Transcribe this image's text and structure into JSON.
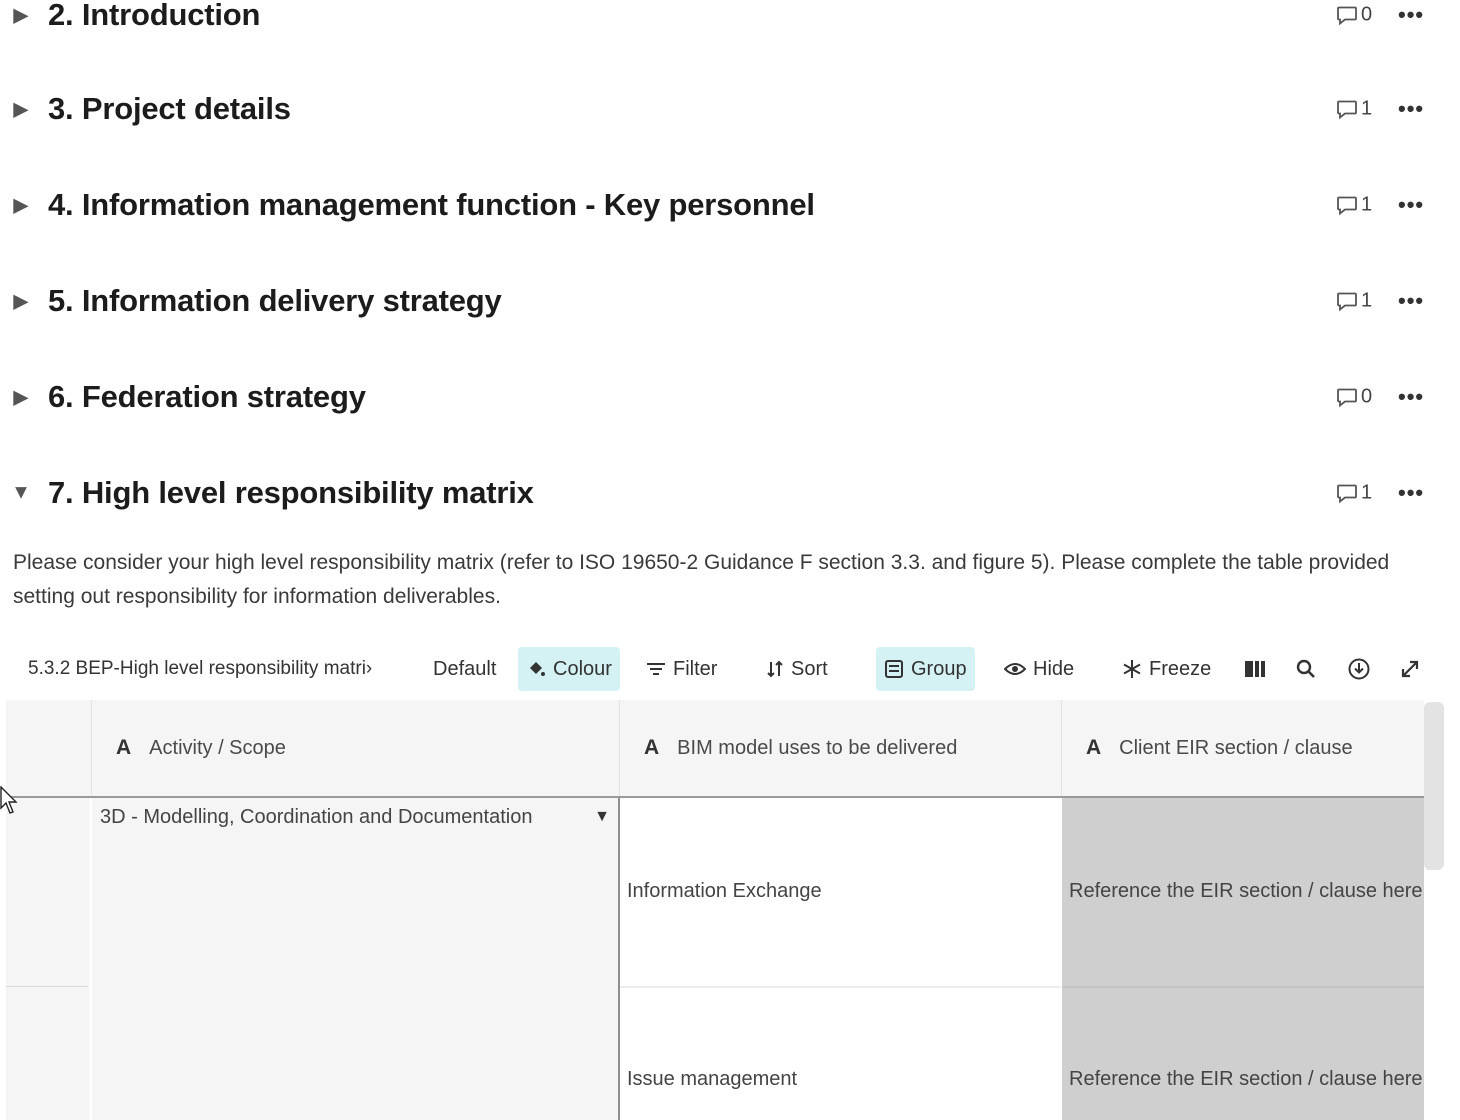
{
  "sections": [
    {
      "title": "2. Introduction",
      "comments": "0",
      "expanded": false
    },
    {
      "title": "3. Project details",
      "comments": "1",
      "expanded": false
    },
    {
      "title": "4. Information management function - Key personnel",
      "comments": "1",
      "expanded": false
    },
    {
      "title": "5. Information delivery strategy",
      "comments": "1",
      "expanded": false
    },
    {
      "title": "6. Federation strategy",
      "comments": "0",
      "expanded": false
    },
    {
      "title": "7. High level responsibility matrix",
      "comments": "1",
      "expanded": true
    }
  ],
  "icons": {
    "collapsed": "▶",
    "expanded": "▼",
    "more": "•••"
  },
  "description": "Please consider your high level responsibility matrix (refer to ISO 19650-2 Guidance F section 3.3. and figure 5).  Please complete the table provided setting out responsibility for information deliverables.",
  "toolbar": {
    "view_name": "5.3.2 BEP-High level responsibility matri›",
    "default_label": "Default",
    "colour_label": "Colour",
    "filter_label": "Filter",
    "sort_label": "Sort",
    "group_label": "Group",
    "hide_label": "Hide",
    "freeze_label": "Freeze"
  },
  "table": {
    "columns": [
      {
        "type_icon": "A",
        "label": "Activity / Scope"
      },
      {
        "type_icon": "A",
        "label": "BIM model uses to be delivered"
      },
      {
        "type_icon": "A",
        "label": "Client EIR section / clause"
      }
    ],
    "group_value": "3D - Modelling, Coordination and Documentation",
    "rows": [
      {
        "bim_use": "Information Exchange",
        "eir_ref": "Reference the EIR section  / clause here"
      },
      {
        "bim_use": "Issue management",
        "eir_ref": "Reference the EIR section  / clause here"
      }
    ]
  },
  "colors": {
    "active_tool_bg": "#d4f1f4",
    "header_bg": "#f5f5f5",
    "readonly_cell_bg": "#cfcfcf"
  }
}
